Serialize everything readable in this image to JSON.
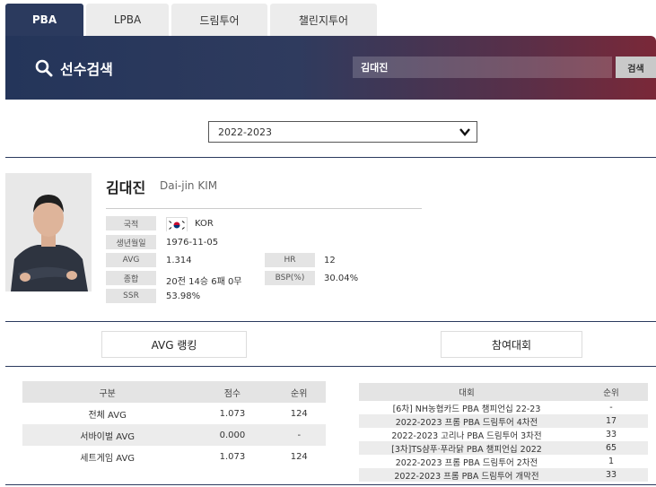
{
  "tabs": [
    {
      "label": "PBA",
      "active": true
    },
    {
      "label": "LPBA",
      "active": false
    },
    {
      "label": "드림투어",
      "active": false
    },
    {
      "label": "챌린지투어",
      "active": false
    }
  ],
  "header": {
    "title": "선수검색",
    "search_value": "김대진",
    "search_button": "검색",
    "gradient_colors": [
      "#24355a",
      "#7a2838"
    ]
  },
  "season": {
    "selected": "2022-2023"
  },
  "player": {
    "name": "김대진",
    "name_en": "Dai-jin KIM",
    "fields": {
      "nationality_label": "국적",
      "nationality": "KOR",
      "birth_label": "생년월일",
      "birth": "1976-11-05",
      "avg_label": "AVG",
      "avg": "1.314",
      "hr_label": "HR",
      "hr": "12",
      "record_label": "종합",
      "record": "20전 14승 6패 0무",
      "bsp_label": "BSP(%)",
      "bsp": "30.04%",
      "ssr_label": "SSR",
      "ssr": "53.98%"
    }
  },
  "buttons": {
    "avg_ranking": "AVG 랭킹",
    "tournaments": "참여대회"
  },
  "avg_table": {
    "headers": [
      "구분",
      "점수",
      "순위"
    ],
    "rows": [
      [
        "전체 AVG",
        "1.073",
        "124"
      ],
      [
        "서바이벌 AVG",
        "0.000",
        "-"
      ],
      [
        "세트게임 AVG",
        "1.073",
        "124"
      ]
    ]
  },
  "tournament_table": {
    "headers": [
      "대회",
      "순위"
    ],
    "rows": [
      [
        "[6차] NH농협카드 PBA 챔피언십 22-23",
        "-"
      ],
      [
        "2022-2023 프롬 PBA 드림투어 4차전",
        "17"
      ],
      [
        "2022-2023 고리나 PBA 드림투어 3차전",
        "33"
      ],
      [
        "[3차]TS샴푸·푸라닭 PBA 챔피언십 2022",
        "65"
      ],
      [
        "2022-2023 프롬 PBA 드림투어 2차전",
        "1"
      ],
      [
        "2022-2023 프롬 PBA 드림투어 개막전",
        "33"
      ]
    ]
  }
}
